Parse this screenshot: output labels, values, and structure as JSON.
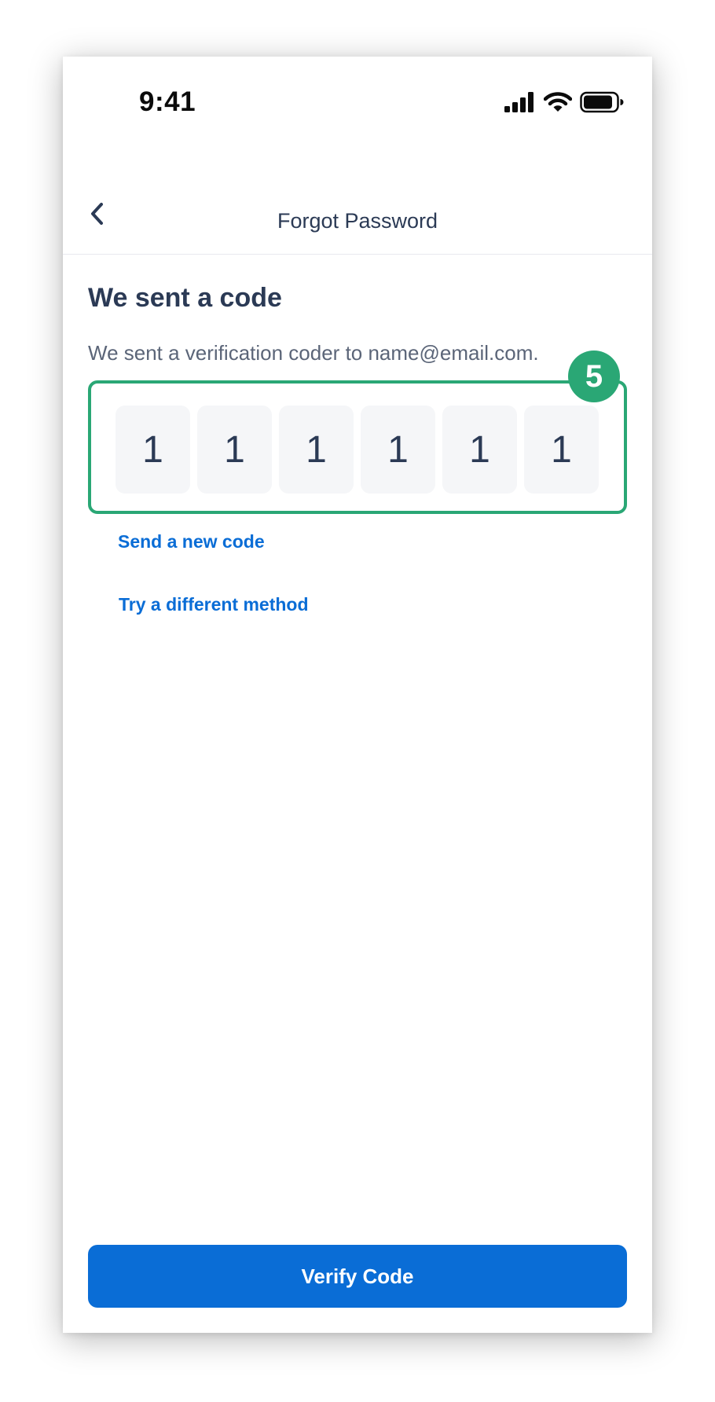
{
  "status_bar": {
    "time": "9:41",
    "icons": [
      "cellular-signal-icon",
      "wifi-icon",
      "battery-icon"
    ]
  },
  "nav": {
    "title": "Forgot Password",
    "back_icon": "chevron-left-icon"
  },
  "content": {
    "heading": "We sent a code",
    "subtext": "We sent a verification coder to name@email.com.",
    "step_badge": "5",
    "code_digits": [
      "1",
      "1",
      "1",
      "1",
      "1",
      "1"
    ],
    "resend_link": "Send a new code",
    "method_link": "Try a different method"
  },
  "footer": {
    "verify_label": "Verify Code"
  },
  "colors": {
    "primary": "#0A6DD6",
    "highlight": "#2AA775",
    "text_dark": "#2B3A55",
    "text_muted": "#5B6578",
    "input_bg": "#F5F6F8"
  }
}
